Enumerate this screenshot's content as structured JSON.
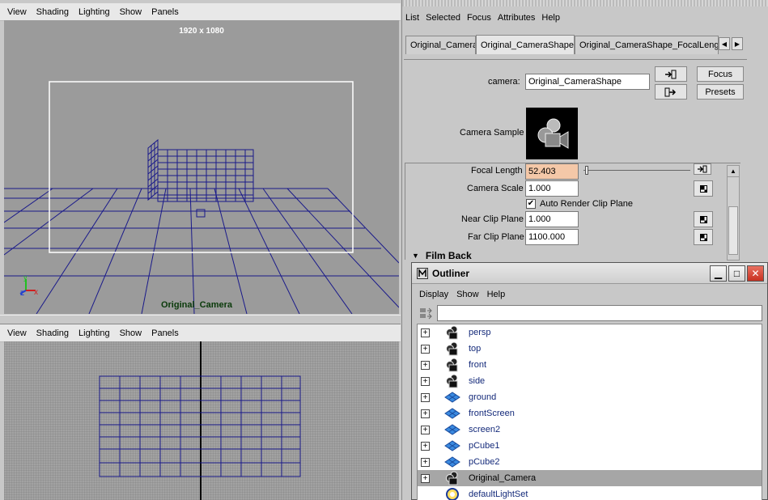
{
  "viewport_top": {
    "menu": [
      "View",
      "Shading",
      "Lighting",
      "Show",
      "Panels"
    ],
    "resolution_label": "1920 x 1080",
    "camera_label": "Original_Camera",
    "axis_labels": {
      "y": "y",
      "z": "z",
      "x": "x"
    }
  },
  "viewport_bottom": {
    "menu": [
      "View",
      "Shading",
      "Lighting",
      "Show",
      "Panels"
    ]
  },
  "attribute_editor": {
    "menu": [
      "List",
      "Selected",
      "Focus",
      "Attributes",
      "Help"
    ],
    "tabs": [
      "Original_Camera",
      "Original_CameraShape",
      "Original_CameraShape_FocalLength"
    ],
    "active_tab": "Original_CameraShape",
    "node_label": "camera:",
    "node_value": "Original_CameraShape",
    "focus_button": "Focus",
    "presets_button": "Presets",
    "sample_label": "Camera Sample",
    "attributes": [
      {
        "label": "Focal Length",
        "value": "52.403",
        "highlight_color": "#f4c8a8"
      },
      {
        "label": "Camera Scale",
        "value": "1.000"
      },
      {
        "label": "Near Clip Plane",
        "value": "1.000"
      },
      {
        "label": "Far Clip Plane",
        "value": "1100.000"
      }
    ],
    "auto_render_clip_plane": {
      "label": "Auto Render Clip Plane",
      "checked": true
    },
    "focal_slider_fraction": 0.02,
    "section_film_back": "Film Back"
  },
  "outliner": {
    "title": "Outliner",
    "menu": [
      "Display",
      "Show",
      "Help"
    ],
    "items": [
      {
        "label": "persp",
        "icon": "camera-icon",
        "selected": false
      },
      {
        "label": "top",
        "icon": "camera-icon",
        "selected": false
      },
      {
        "label": "front",
        "icon": "camera-icon",
        "selected": false
      },
      {
        "label": "side",
        "icon": "camera-icon",
        "selected": false
      },
      {
        "label": "ground",
        "icon": "mesh-icon",
        "selected": false
      },
      {
        "label": "frontScreen",
        "icon": "mesh-icon",
        "selected": false
      },
      {
        "label": "screen2",
        "icon": "mesh-icon",
        "selected": false
      },
      {
        "label": "pCube1",
        "icon": "mesh-icon",
        "selected": false
      },
      {
        "label": "pCube2",
        "icon": "mesh-icon",
        "selected": false
      },
      {
        "label": "Original_Camera",
        "icon": "camera-icon",
        "selected": true
      },
      {
        "label": "defaultLightSet",
        "icon": "light-set-icon",
        "selected": false
      }
    ]
  },
  "colors": {
    "wireframe": "#1a1a8a",
    "viewport_bg": "#9b9b9b",
    "selection": "#a6a6a6"
  }
}
